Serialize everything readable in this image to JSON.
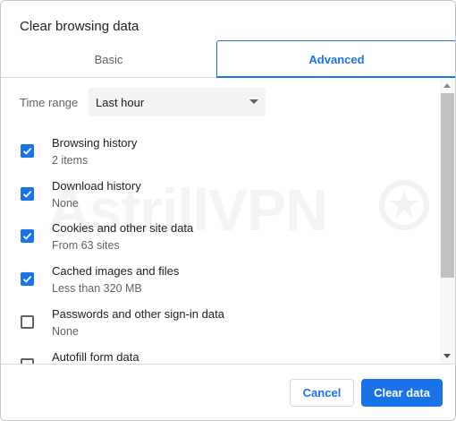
{
  "dialog": {
    "title": "Clear browsing data"
  },
  "tabs": [
    {
      "label": "Basic",
      "active": false
    },
    {
      "label": "Advanced",
      "active": true
    }
  ],
  "time_range": {
    "label": "Time range",
    "value": "Last hour"
  },
  "options": [
    {
      "title": "Browsing history",
      "subtitle": "2 items",
      "checked": true
    },
    {
      "title": "Download history",
      "subtitle": "None",
      "checked": true
    },
    {
      "title": "Cookies and other site data",
      "subtitle": "From 63 sites",
      "checked": true
    },
    {
      "title": "Cached images and files",
      "subtitle": "Less than 320 MB",
      "checked": true
    },
    {
      "title": "Passwords and other sign-in data",
      "subtitle": "None",
      "checked": false
    },
    {
      "title": "Autofill form data",
      "subtitle": "",
      "checked": false
    }
  ],
  "watermark": {
    "text": "AstrillVPN"
  },
  "buttons": {
    "cancel": "Cancel",
    "clear": "Clear data"
  },
  "colors": {
    "accent": "#1a73e8",
    "text": "#202124",
    "secondary_text": "#5f6368"
  }
}
